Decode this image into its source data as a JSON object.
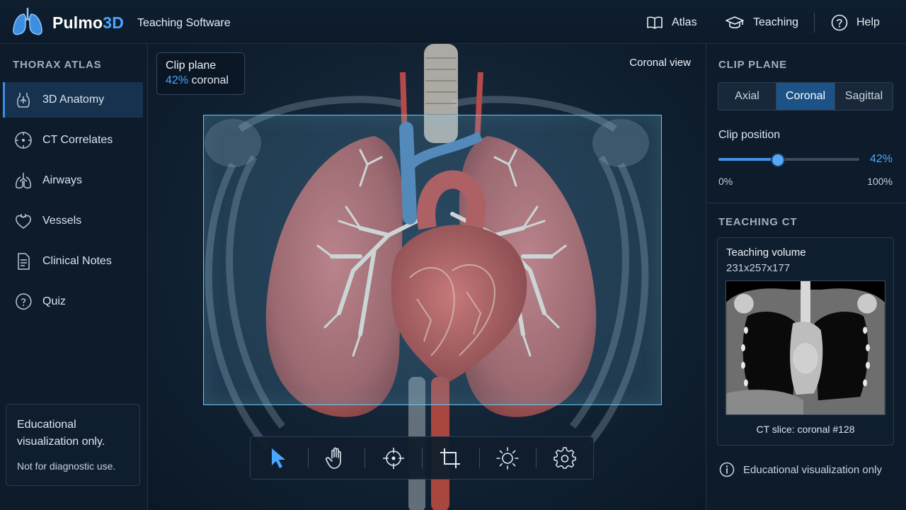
{
  "header": {
    "brand_main": "Pulmo",
    "brand_accent": "3D",
    "subtitle": "Teaching Software",
    "nav": [
      {
        "label": "Atlas",
        "icon": "book-icon"
      },
      {
        "label": "Teaching",
        "icon": "graduation-cap-icon"
      },
      {
        "label": "Help",
        "icon": "help-circle-icon"
      }
    ]
  },
  "sidebar": {
    "title": "THORAX ATLAS",
    "items": [
      {
        "label": "3D Anatomy",
        "icon": "torso-icon",
        "active": true
      },
      {
        "label": "CT Correlates",
        "icon": "ct-scan-icon",
        "active": false
      },
      {
        "label": "Airways",
        "icon": "airways-icon",
        "active": false
      },
      {
        "label": "Vessels",
        "icon": "heart-vessel-icon",
        "active": false
      },
      {
        "label": "Clinical Notes",
        "icon": "document-icon",
        "active": false
      },
      {
        "label": "Quiz",
        "icon": "quiz-icon",
        "active": false
      }
    ],
    "disclaimer": {
      "line1": "Educational visualization only.",
      "line2": "Not for diagnostic use."
    }
  },
  "viewport": {
    "clip_badge": {
      "title": "Clip plane",
      "percent": "42%",
      "plane": " coronal"
    },
    "view_label": "Coronal view",
    "tools": [
      {
        "name": "select-tool",
        "icon": "cursor-arrow-icon",
        "active": true
      },
      {
        "name": "pan-tool",
        "icon": "hand-icon",
        "active": false
      },
      {
        "name": "target-tool",
        "icon": "crosshair-icon",
        "active": false
      },
      {
        "name": "crop-tool",
        "icon": "crop-icon",
        "active": false
      },
      {
        "name": "brightness-tool",
        "icon": "sun-icon",
        "active": false
      },
      {
        "name": "settings-tool",
        "icon": "gear-icon",
        "active": false
      }
    ]
  },
  "right_panel": {
    "clip_title": "CLIP PLANE",
    "planes": [
      {
        "label": "Axial",
        "active": false
      },
      {
        "label": "Coronal",
        "active": true
      },
      {
        "label": "Sagittal",
        "active": false
      }
    ],
    "clip_position_label": "Clip position",
    "clip_position_value": 0.42,
    "clip_position_text": "42%",
    "range_min": "0%",
    "range_max": "100%",
    "ct_title": "TEACHING CT",
    "ct_card": {
      "title": "Teaching volume",
      "dims": "231x257x177",
      "caption": "CT slice: coronal #128"
    },
    "edu_note": "Educational visualization only"
  },
  "colors": {
    "accent": "#4aa6ff",
    "active_segment": "#1c5286",
    "background": "#0b1826",
    "clip_box_border": "#67c7ef"
  }
}
